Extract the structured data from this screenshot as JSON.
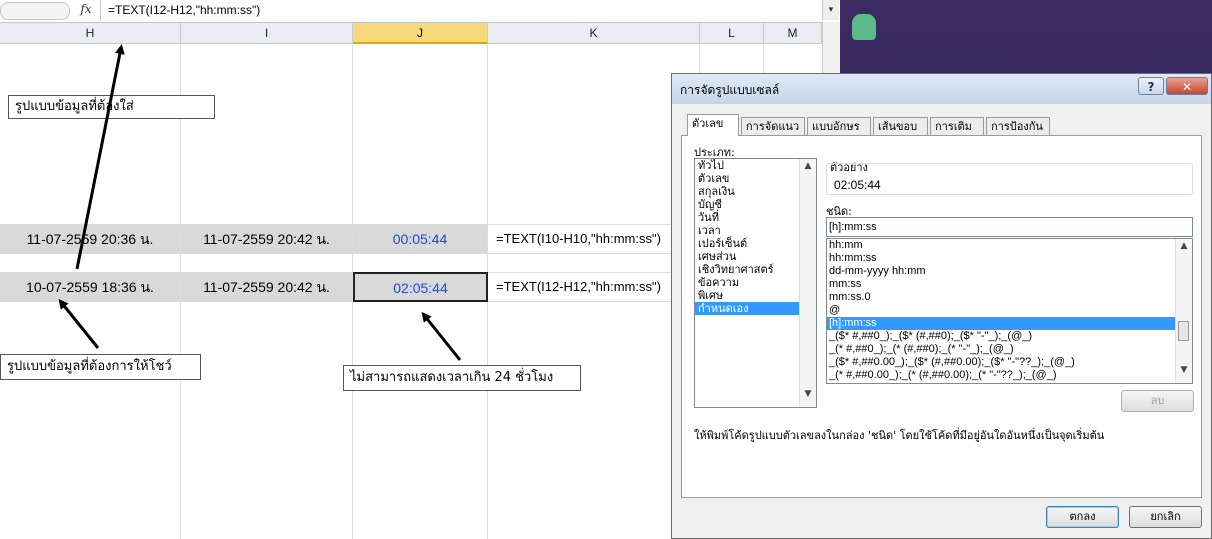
{
  "formula_bar": {
    "fx_label": "fx",
    "formula": "=TEXT(I12-H12,\"hh:mm:ss\")",
    "dropdown_glyph": "▾"
  },
  "columns": [
    "H",
    "I",
    "J",
    "K",
    "L",
    "M"
  ],
  "rows": [
    {
      "h": "11-07-2559 20:36 น.",
      "i": "11-07-2559 20:42 น.",
      "j": "00:05:44",
      "k": "=TEXT(I10-H10,\"hh:mm:ss\")"
    },
    {
      "h": "10-07-2559 18:36 น.",
      "i": "11-07-2559 20:42 น.",
      "j": "02:05:44",
      "k": "=TEXT(I12-H12,\"hh:mm:ss\")"
    }
  ],
  "callouts": {
    "format_input": "รูปแบบข้อมูลที่ต้องใส่",
    "format_show": "รูปแบบข้อมูลที่ต้องการให้โชว์",
    "cannot_show": "ไม่สามารถแสดงเวลาเกิน 24 ชั่วโมง"
  },
  "dialog": {
    "title": "การจัดรูปแบบเซลล์",
    "help": "?",
    "close": "✕",
    "tabs": [
      "ตัวเลข",
      "การจัดแนว",
      "แบบอักษร",
      "เส้นขอบ",
      "การเติม",
      "การป้องกัน"
    ],
    "category_label": "ประเภท:",
    "categories": [
      "ทั่วไป",
      "ตัวเลข",
      "สกุลเงิน",
      "บัญชี",
      "วันที่",
      "เวลา",
      "เปอร์เซ็นต์",
      "เศษส่วน",
      "เชิงวิทยาศาสตร์",
      "ข้อความ",
      "พิเศษ",
      "กำหนดเอง"
    ],
    "selected_category": "กำหนดเอง",
    "sample_label": "ตัวอย่าง",
    "sample_value": "02:05:44",
    "type_label": "ชนิด:",
    "type_value": "[h]:mm:ss",
    "formats": [
      "hh:mm",
      "hh:mm:ss",
      "dd-mm-yyyy hh:mm",
      "mm:ss",
      "mm:ss.0",
      "@",
      "[h]:mm:ss",
      "_($* #,##0_);_($* (#,##0);_($* \"-\"_);_(@_)",
      "_(* #,##0_);_(* (#,##0);_(* \"-\"_);_(@_)",
      "_($* #,##0.00_);_($* (#,##0.00);_($* \"-\"??_);_(@_)",
      "_(* #,##0.00_);_(* (#,##0.00);_(* \"-\"??_);_(@_)"
    ],
    "selected_format": "[h]:mm:ss",
    "delete_button": "ลบ",
    "description": "ให้พิมพ์โค้ดรูปแบบตัวเลขลงในกล่อง 'ชนิด' โดยใช้โค้ดที่มีอยู่อันใดอันหนึ่งเป็นจุดเริ่มต้น",
    "ok_button": "ตกลง",
    "cancel_button": "ยกเลิก"
  }
}
